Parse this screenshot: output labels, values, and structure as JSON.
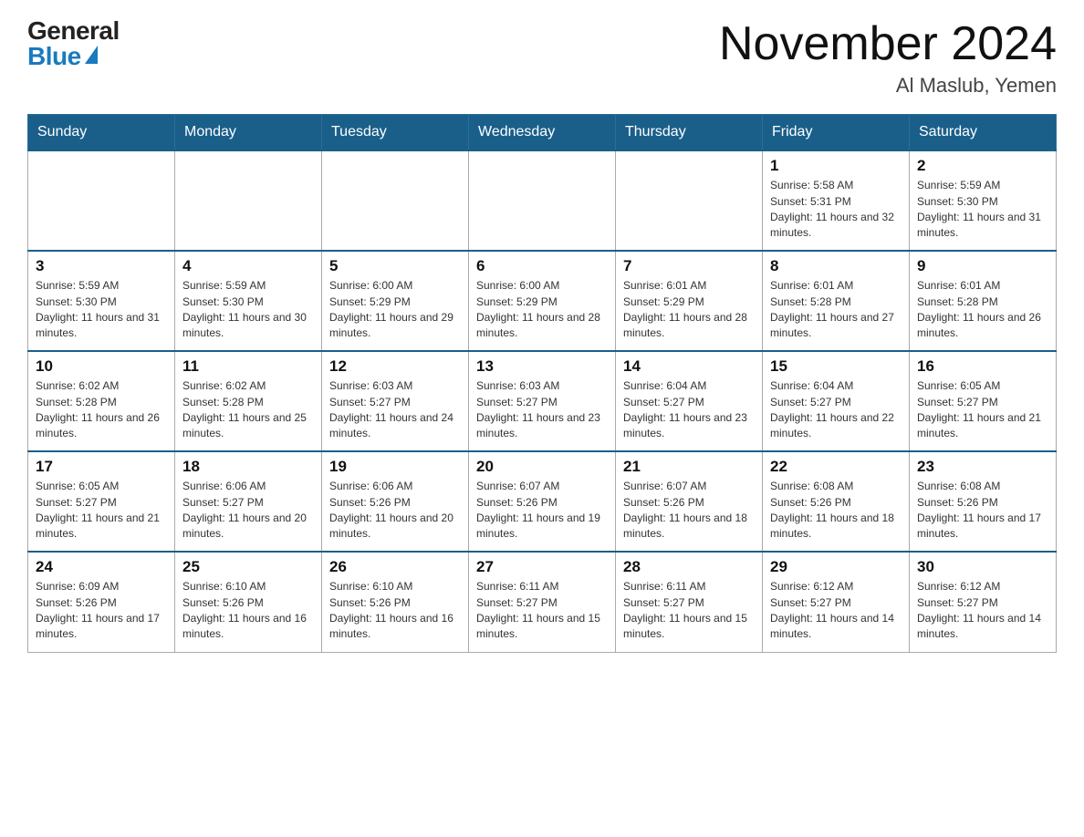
{
  "header": {
    "logo_general": "General",
    "logo_blue": "Blue",
    "main_title": "November 2024",
    "subtitle": "Al Maslub, Yemen"
  },
  "weekdays": [
    "Sunday",
    "Monday",
    "Tuesday",
    "Wednesday",
    "Thursday",
    "Friday",
    "Saturday"
  ],
  "weeks": [
    [
      {
        "day": "",
        "info": ""
      },
      {
        "day": "",
        "info": ""
      },
      {
        "day": "",
        "info": ""
      },
      {
        "day": "",
        "info": ""
      },
      {
        "day": "",
        "info": ""
      },
      {
        "day": "1",
        "info": "Sunrise: 5:58 AM\nSunset: 5:31 PM\nDaylight: 11 hours and 32 minutes."
      },
      {
        "day": "2",
        "info": "Sunrise: 5:59 AM\nSunset: 5:30 PM\nDaylight: 11 hours and 31 minutes."
      }
    ],
    [
      {
        "day": "3",
        "info": "Sunrise: 5:59 AM\nSunset: 5:30 PM\nDaylight: 11 hours and 31 minutes."
      },
      {
        "day": "4",
        "info": "Sunrise: 5:59 AM\nSunset: 5:30 PM\nDaylight: 11 hours and 30 minutes."
      },
      {
        "day": "5",
        "info": "Sunrise: 6:00 AM\nSunset: 5:29 PM\nDaylight: 11 hours and 29 minutes."
      },
      {
        "day": "6",
        "info": "Sunrise: 6:00 AM\nSunset: 5:29 PM\nDaylight: 11 hours and 28 minutes."
      },
      {
        "day": "7",
        "info": "Sunrise: 6:01 AM\nSunset: 5:29 PM\nDaylight: 11 hours and 28 minutes."
      },
      {
        "day": "8",
        "info": "Sunrise: 6:01 AM\nSunset: 5:28 PM\nDaylight: 11 hours and 27 minutes."
      },
      {
        "day": "9",
        "info": "Sunrise: 6:01 AM\nSunset: 5:28 PM\nDaylight: 11 hours and 26 minutes."
      }
    ],
    [
      {
        "day": "10",
        "info": "Sunrise: 6:02 AM\nSunset: 5:28 PM\nDaylight: 11 hours and 26 minutes."
      },
      {
        "day": "11",
        "info": "Sunrise: 6:02 AM\nSunset: 5:28 PM\nDaylight: 11 hours and 25 minutes."
      },
      {
        "day": "12",
        "info": "Sunrise: 6:03 AM\nSunset: 5:27 PM\nDaylight: 11 hours and 24 minutes."
      },
      {
        "day": "13",
        "info": "Sunrise: 6:03 AM\nSunset: 5:27 PM\nDaylight: 11 hours and 23 minutes."
      },
      {
        "day": "14",
        "info": "Sunrise: 6:04 AM\nSunset: 5:27 PM\nDaylight: 11 hours and 23 minutes."
      },
      {
        "day": "15",
        "info": "Sunrise: 6:04 AM\nSunset: 5:27 PM\nDaylight: 11 hours and 22 minutes."
      },
      {
        "day": "16",
        "info": "Sunrise: 6:05 AM\nSunset: 5:27 PM\nDaylight: 11 hours and 21 minutes."
      }
    ],
    [
      {
        "day": "17",
        "info": "Sunrise: 6:05 AM\nSunset: 5:27 PM\nDaylight: 11 hours and 21 minutes."
      },
      {
        "day": "18",
        "info": "Sunrise: 6:06 AM\nSunset: 5:27 PM\nDaylight: 11 hours and 20 minutes."
      },
      {
        "day": "19",
        "info": "Sunrise: 6:06 AM\nSunset: 5:26 PM\nDaylight: 11 hours and 20 minutes."
      },
      {
        "day": "20",
        "info": "Sunrise: 6:07 AM\nSunset: 5:26 PM\nDaylight: 11 hours and 19 minutes."
      },
      {
        "day": "21",
        "info": "Sunrise: 6:07 AM\nSunset: 5:26 PM\nDaylight: 11 hours and 18 minutes."
      },
      {
        "day": "22",
        "info": "Sunrise: 6:08 AM\nSunset: 5:26 PM\nDaylight: 11 hours and 18 minutes."
      },
      {
        "day": "23",
        "info": "Sunrise: 6:08 AM\nSunset: 5:26 PM\nDaylight: 11 hours and 17 minutes."
      }
    ],
    [
      {
        "day": "24",
        "info": "Sunrise: 6:09 AM\nSunset: 5:26 PM\nDaylight: 11 hours and 17 minutes."
      },
      {
        "day": "25",
        "info": "Sunrise: 6:10 AM\nSunset: 5:26 PM\nDaylight: 11 hours and 16 minutes."
      },
      {
        "day": "26",
        "info": "Sunrise: 6:10 AM\nSunset: 5:26 PM\nDaylight: 11 hours and 16 minutes."
      },
      {
        "day": "27",
        "info": "Sunrise: 6:11 AM\nSunset: 5:27 PM\nDaylight: 11 hours and 15 minutes."
      },
      {
        "day": "28",
        "info": "Sunrise: 6:11 AM\nSunset: 5:27 PM\nDaylight: 11 hours and 15 minutes."
      },
      {
        "day": "29",
        "info": "Sunrise: 6:12 AM\nSunset: 5:27 PM\nDaylight: 11 hours and 14 minutes."
      },
      {
        "day": "30",
        "info": "Sunrise: 6:12 AM\nSunset: 5:27 PM\nDaylight: 11 hours and 14 minutes."
      }
    ]
  ]
}
